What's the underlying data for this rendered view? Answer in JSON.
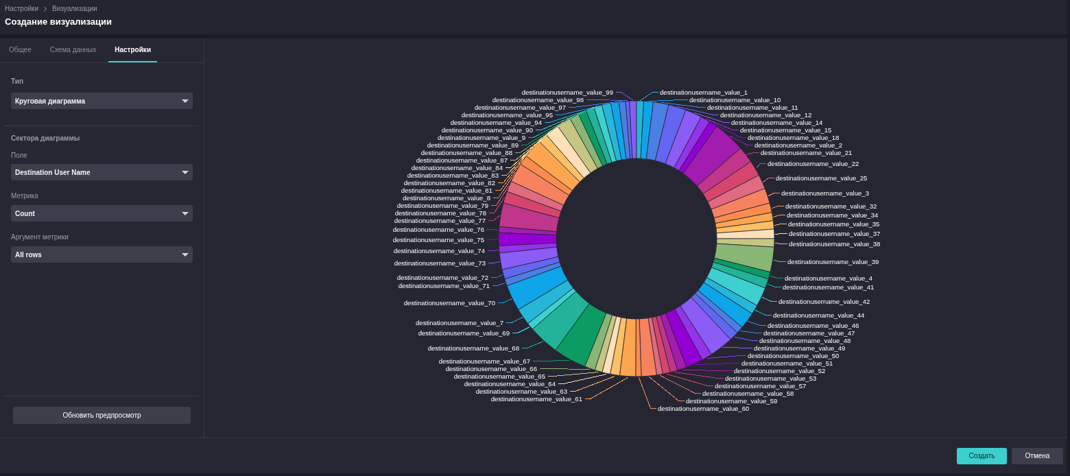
{
  "breadcrumb": [
    {
      "label": "Настройки"
    },
    {
      "label": "Визуализации"
    }
  ],
  "title": "Создание визуализации",
  "tabs": [
    {
      "label": "Общее",
      "selected": false
    },
    {
      "label": "Схема данных",
      "selected": false
    },
    {
      "label": "Настройки",
      "selected": true
    }
  ],
  "settings": {
    "type_field": {
      "label": "Тип",
      "value": "Круговая диаграмма"
    },
    "section_title": "Сектора диаграммы",
    "fields": [
      {
        "label": "Поле",
        "value": "Destination User Name"
      },
      {
        "label": "Метрика",
        "value": "Count"
      },
      {
        "label": "Аргумент метрики",
        "value": "All rows"
      }
    ],
    "preview_button": "Обновить предпросмотр"
  },
  "chart": {
    "left_slices": [
      {
        "label": "destinationusername_value_99",
        "color": "#8b5cf6"
      },
      {
        "label": "destinationusername_value_98",
        "color": "#6366f1"
      },
      {
        "label": "destinationusername_value_97",
        "color": "#4b7fe3"
      },
      {
        "label": "destinationusername_value_95",
        "color": "#0ea5e9"
      },
      {
        "label": "destinationusername_value_94",
        "color": "#26b6d8"
      },
      {
        "label": "destinationusername_value_90",
        "color": "#3dd0cf"
      },
      {
        "label": "destinationusername_value_9",
        "color": "#22b39a"
      },
      {
        "label": "destinationusername_value_89",
        "color": "#0b9b63"
      },
      {
        "label": "destinationusername_value_88",
        "color": "#88b674"
      },
      {
        "label": "destinationusername_value_87",
        "color": "#c6c582"
      },
      {
        "label": "destinationusername_value_84",
        "color": "#fde0b8"
      },
      {
        "label": "destinationusername_value_83",
        "color": "#fdc066"
      },
      {
        "label": "destinationusername_value_82",
        "color": "#fda54f"
      },
      {
        "label": "destinationusername_value_81",
        "color": "#fb8c4e"
      },
      {
        "label": "destinationusername_value_8",
        "color": "#f7825f"
      },
      {
        "label": "destinationusername_value_79",
        "color": "#e06a80"
      },
      {
        "label": "destinationusername_value_78",
        "color": "#d6456e"
      },
      {
        "label": "destinationusername_value_77",
        "color": "#c0368c"
      },
      {
        "label": "destinationusername_value_76",
        "color": "#a21caf"
      },
      {
        "label": "destinationusername_value_75",
        "color": "#9400d3"
      },
      {
        "label": "destinationusername_value_74",
        "color": "#9333ea"
      },
      {
        "label": "destinationusername_value_73",
        "color": "#8b5cf6"
      },
      {
        "label": "destinationusername_value_72",
        "color": "#6366f1"
      },
      {
        "label": "destinationusername_value_71",
        "color": "#4b7fe3"
      },
      {
        "label": "destinationusername_value_70",
        "color": "#0ea5e9"
      },
      {
        "label": "destinationusername_value_7",
        "color": "#26b6d8"
      },
      {
        "label": "destinationusername_value_69",
        "color": "#3dd0cf"
      },
      {
        "label": "destinationusername_value_68",
        "color": "#22b39a"
      },
      {
        "label": "destinationusername_value_67",
        "color": "#0b9b63"
      },
      {
        "label": "destinationusername_value_66",
        "color": "#88b674"
      },
      {
        "label": "destinationusername_value_65",
        "color": "#c6c582"
      },
      {
        "label": "destinationusername_value_64",
        "color": "#fde0b8"
      },
      {
        "label": "destinationusername_value_63",
        "color": "#fdc066"
      },
      {
        "label": "destinationusername_value_61",
        "color": "#fda54f"
      }
    ],
    "right_slices": [
      {
        "label": "destinationusername_value_1",
        "color": "#26b6d8"
      },
      {
        "label": "destinationusername_value_10",
        "color": "#0ea5e9"
      },
      {
        "label": "destinationusername_value_11",
        "color": "#4b7fe3"
      },
      {
        "label": "destinationusername_value_12",
        "color": "#6366f1"
      },
      {
        "label": "destinationusername_value_14",
        "color": "#8b5cf6"
      },
      {
        "label": "destinationusername_value_15",
        "color": "#9333ea"
      },
      {
        "label": "destinationusername_value_18",
        "color": "#9400d3"
      },
      {
        "label": "destinationusername_value_2",
        "color": "#a21caf"
      },
      {
        "label": "destinationusername_value_21",
        "color": "#c0368c"
      },
      {
        "label": "destinationusername_value_22",
        "color": "#d6456e"
      },
      {
        "label": "destinationusername_value_25",
        "color": "#e06a80"
      },
      {
        "label": "destinationusername_value_3",
        "color": "#f7825f"
      },
      {
        "label": "destinationusername_value_32",
        "color": "#fb8c4e"
      },
      {
        "label": "destinationusername_value_34",
        "color": "#fda54f"
      },
      {
        "label": "destinationusername_value_35",
        "color": "#fdc066"
      },
      {
        "label": "destinationusername_value_37",
        "color": "#fde0b8"
      },
      {
        "label": "destinationusername_value_38",
        "color": "#c6c582"
      },
      {
        "label": "destinationusername_value_39",
        "color": "#88b674"
      },
      {
        "label": "destinationusername_value_4",
        "color": "#0b9b63"
      },
      {
        "label": "destinationusername_value_41",
        "color": "#22b39a"
      },
      {
        "label": "destinationusername_value_42",
        "color": "#3dd0cf"
      },
      {
        "label": "destinationusername_value_44",
        "color": "#26b6d8"
      },
      {
        "label": "destinationusername_value_46",
        "color": "#0ea5e9"
      },
      {
        "label": "destinationusername_value_47",
        "color": "#4b7fe3"
      },
      {
        "label": "destinationusername_value_48",
        "color": "#6366f1"
      },
      {
        "label": "destinationusername_value_49",
        "color": "#8b5cf6"
      },
      {
        "label": "destinationusername_value_50",
        "color": "#9333ea"
      },
      {
        "label": "destinationusername_value_51",
        "color": "#9400d3"
      },
      {
        "label": "destinationusername_value_52",
        "color": "#a21caf"
      },
      {
        "label": "destinationusername_value_53",
        "color": "#c0368c"
      },
      {
        "label": "destinationusername_value_57",
        "color": "#d6456e"
      },
      {
        "label": "destinationusername_value_58",
        "color": "#e06a80"
      },
      {
        "label": "destinationusername_value_59",
        "color": "#f7825f"
      },
      {
        "label": "destinationusername_value_60",
        "color": "#fb8c4e"
      }
    ]
  },
  "buttons": [
    {
      "label": "Создать",
      "kind": "primary"
    },
    {
      "label": "Отмена",
      "kind": "secondary"
    }
  ]
}
